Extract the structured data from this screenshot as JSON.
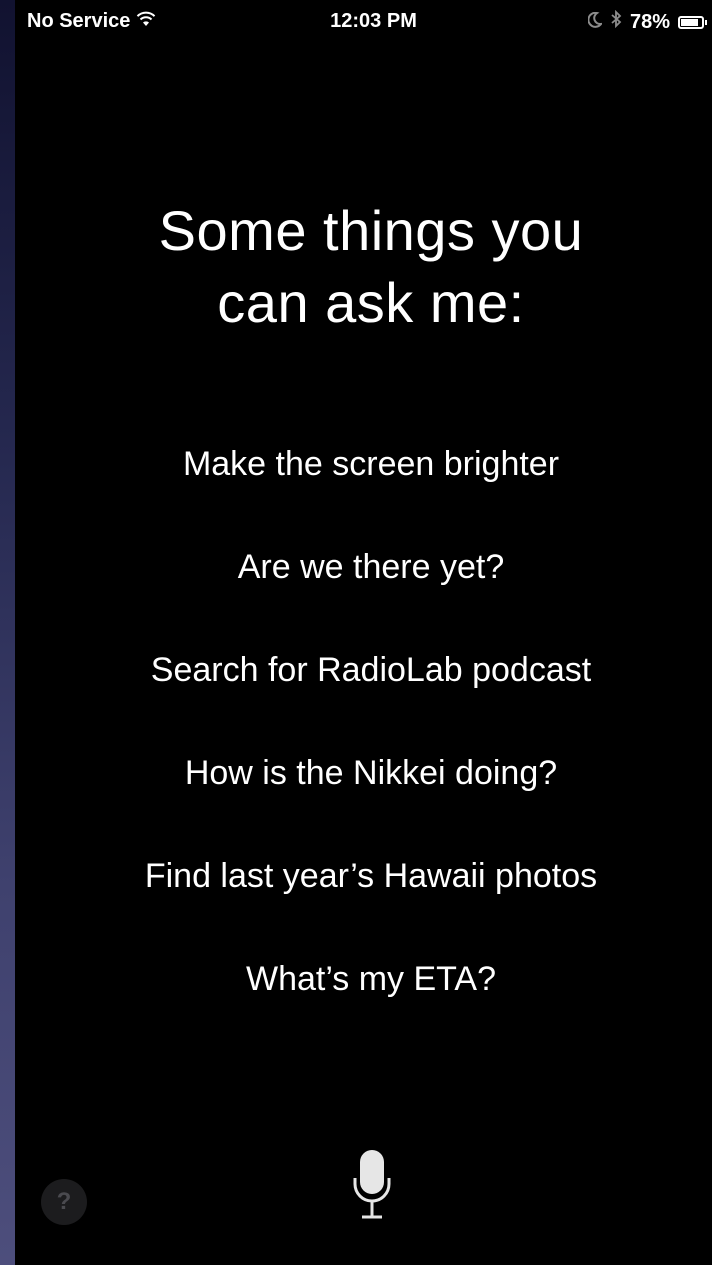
{
  "status_bar": {
    "carrier": "No Service",
    "time": "12:03 PM",
    "battery_percent": "78%",
    "battery_level": 0.78,
    "icons": [
      "wifi-icon",
      "moon-icon",
      "bluetooth-icon",
      "battery-icon"
    ]
  },
  "siri": {
    "heading_line1": "Some things you",
    "heading_line2": "can ask me:",
    "suggestions": [
      "Make the screen brighter",
      "Are we there yet?",
      "Search for RadioLab podcast",
      "How is the Nikkei doing?",
      "Find last year’s Hawaii photos",
      "What’s my ETA?"
    ],
    "help_label": "?",
    "mic_icon": "microphone-icon"
  },
  "colors": {
    "background": "#000000",
    "text": "#ffffff",
    "help_bg": "#1c1c1e",
    "help_text": "#4a4a4f"
  }
}
